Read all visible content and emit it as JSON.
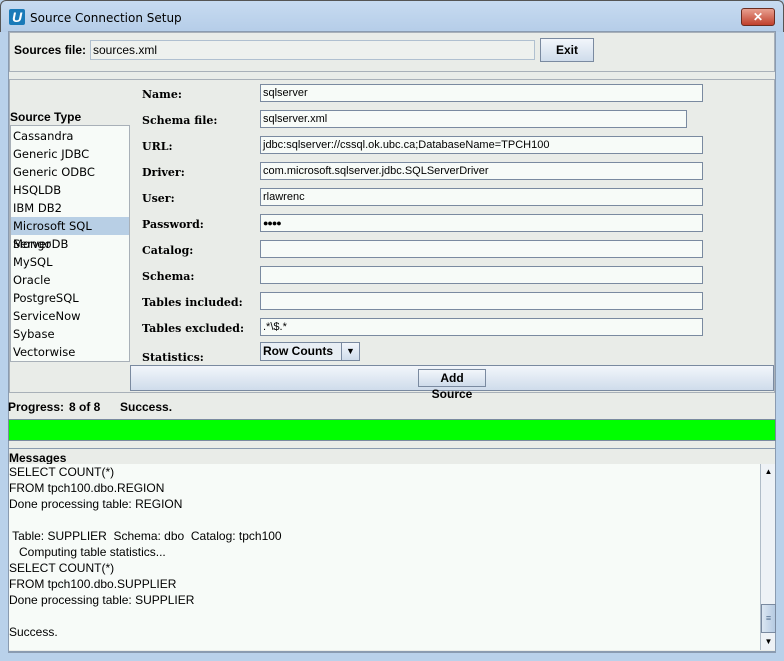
{
  "window": {
    "title": "Source Connection Setup",
    "close_icon": "close-icon",
    "app_icon": "U"
  },
  "sources_file": {
    "label": "Sources file:",
    "value": "sources.xml",
    "exit_label": "Exit"
  },
  "source_type": {
    "label": "Source Type",
    "items": [
      "Cassandra",
      "Generic JDBC",
      "Generic ODBC",
      "HSQLDB",
      "IBM DB2",
      "Microsoft SQL Server",
      "MongoDB",
      "MySQL",
      "Oracle",
      "PostgreSQL",
      "ServiceNow",
      "Sybase",
      "Vectorwise"
    ],
    "selected": "Microsoft SQL Server"
  },
  "form": {
    "name": {
      "label": "Name:",
      "value": "sqlserver"
    },
    "schema_file": {
      "label": "Schema file:",
      "value": "sqlserver.xml"
    },
    "url": {
      "label": "URL:",
      "value": "jdbc:sqlserver://cssql.ok.ubc.ca;DatabaseName=TPCH100"
    },
    "driver": {
      "label": "Driver:",
      "value": "com.microsoft.sqlserver.jdbc.SQLServerDriver"
    },
    "user": {
      "label": "User:",
      "value": "rlawrenc"
    },
    "password": {
      "label": "Password:",
      "value": "●●●●"
    },
    "catalog": {
      "label": "Catalog:",
      "value": ""
    },
    "schema": {
      "label": "Schema:",
      "value": ""
    },
    "tables_included": {
      "label": "Tables included:",
      "value": ""
    },
    "tables_excluded": {
      "label": "Tables excluded:",
      "value": ".*\\$.*"
    },
    "statistics": {
      "label": "Statistics:",
      "value": "Row Counts"
    },
    "add_source_label": "Add Source"
  },
  "progress": {
    "label": "Progress:",
    "count": "8 of 8",
    "status": "Success.",
    "percent": 100,
    "color": "#00ff00"
  },
  "messages": {
    "label": "Messages",
    "lines": [
      "SELECT COUNT(*)",
      "FROM tpch100.dbo.REGION",
      "Done processing table: REGION",
      "",
      " Table: SUPPLIER  Schema: dbo  Catalog: tpch100",
      "   Computing table statistics...",
      "SELECT COUNT(*)",
      "FROM tpch100.dbo.SUPPLIER",
      "Done processing table: SUPPLIER",
      "",
      "Success."
    ]
  }
}
